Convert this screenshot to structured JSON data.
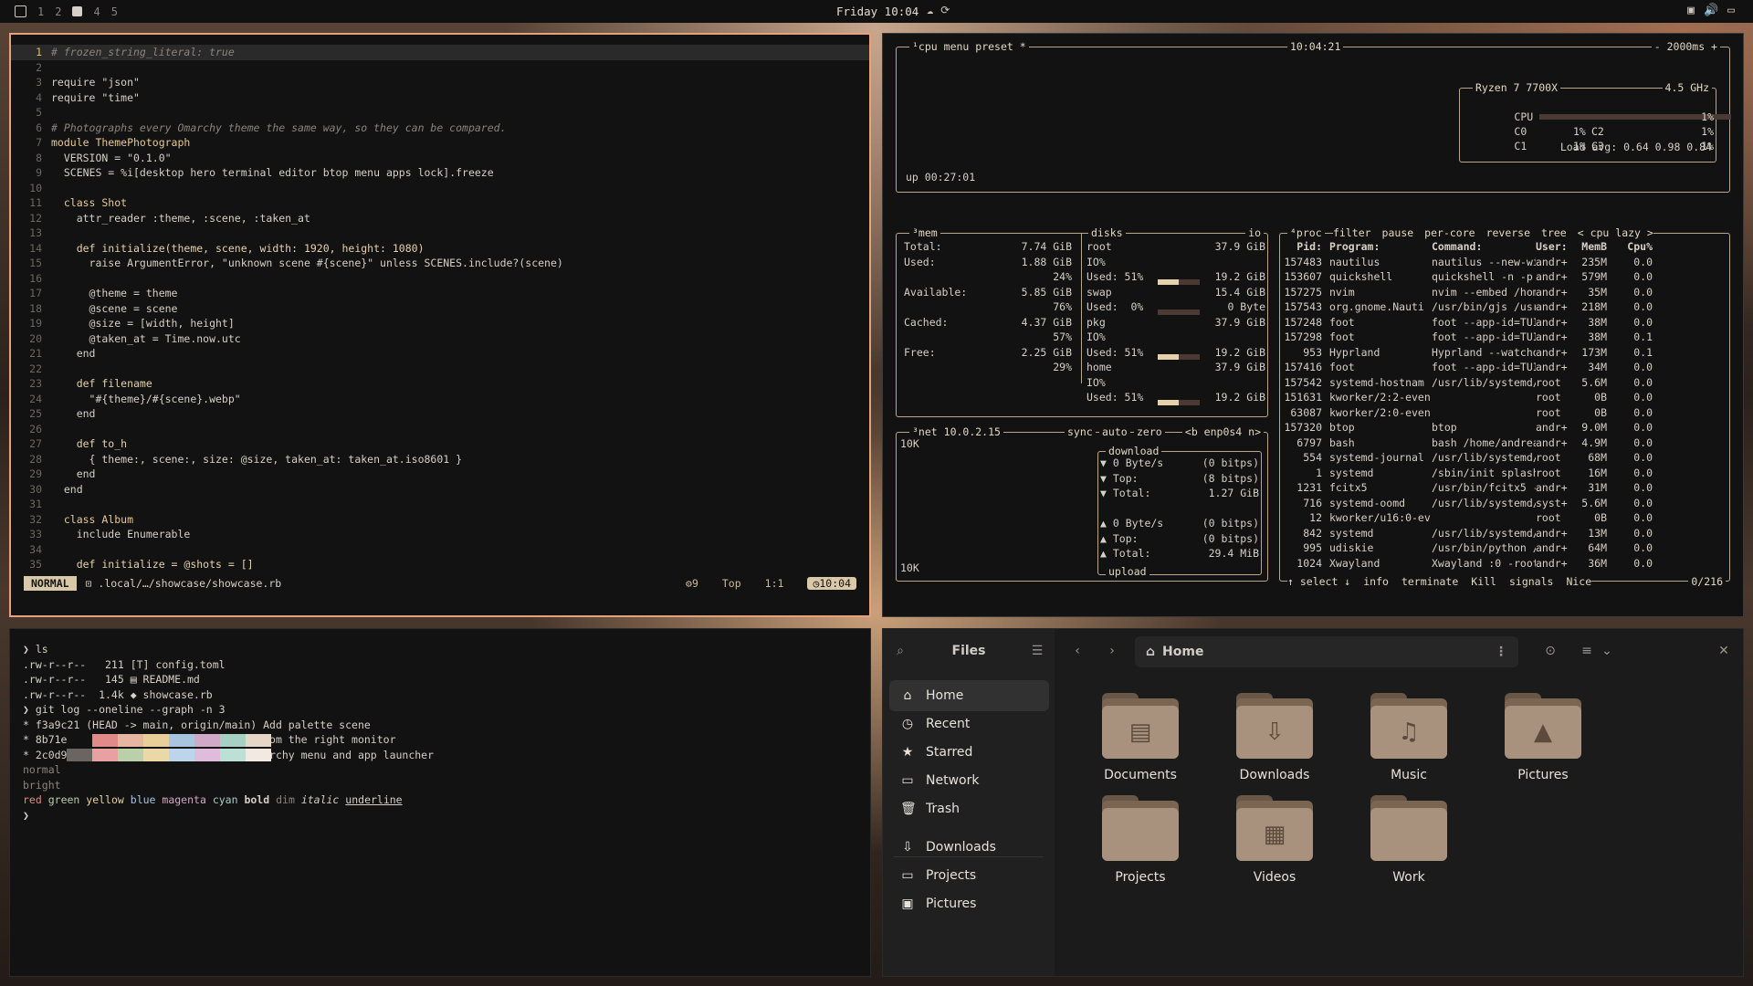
{
  "topbar": {
    "workspaces": [
      "1",
      "2",
      "4",
      "5"
    ],
    "clock": "Friday 10:04"
  },
  "editor": {
    "lines": [
      {
        "n": "1",
        "t": "# frozen_string_literal: true"
      },
      {
        "n": "2",
        "t": ""
      },
      {
        "n": "3",
        "t": "require \"json\""
      },
      {
        "n": "4",
        "t": "require \"time\""
      },
      {
        "n": "5",
        "t": ""
      },
      {
        "n": "6",
        "t": "# Photographs every Omarchy theme the same way, so they can be compared."
      },
      {
        "n": "7",
        "t": "module ThemePhotograph"
      },
      {
        "n": "8",
        "t": "  VERSION = \"0.1.0\""
      },
      {
        "n": "9",
        "t": "  SCENES = %i[desktop hero terminal editor btop menu apps lock].freeze"
      },
      {
        "n": "10",
        "t": ""
      },
      {
        "n": "11",
        "t": "  class Shot"
      },
      {
        "n": "12",
        "t": "    attr_reader :theme, :scene, :taken_at"
      },
      {
        "n": "13",
        "t": ""
      },
      {
        "n": "14",
        "t": "    def initialize(theme, scene, width: 1920, height: 1080)"
      },
      {
        "n": "15",
        "t": "      raise ArgumentError, \"unknown scene #{scene}\" unless SCENES.include?(scene)"
      },
      {
        "n": "16",
        "t": ""
      },
      {
        "n": "17",
        "t": "      @theme = theme"
      },
      {
        "n": "18",
        "t": "      @scene = scene"
      },
      {
        "n": "19",
        "t": "      @size = [width, height]"
      },
      {
        "n": "20",
        "t": "      @taken_at = Time.now.utc"
      },
      {
        "n": "21",
        "t": "    end"
      },
      {
        "n": "22",
        "t": ""
      },
      {
        "n": "23",
        "t": "    def filename"
      },
      {
        "n": "24",
        "t": "      \"#{theme}/#{scene}.webp\""
      },
      {
        "n": "25",
        "t": "    end"
      },
      {
        "n": "26",
        "t": ""
      },
      {
        "n": "27",
        "t": "    def to_h"
      },
      {
        "n": "28",
        "t": "      { theme:, scene:, size: @size, taken_at: taken_at.iso8601 }"
      },
      {
        "n": "29",
        "t": "    end"
      },
      {
        "n": "30",
        "t": "  end"
      },
      {
        "n": "31",
        "t": ""
      },
      {
        "n": "32",
        "t": "  class Album"
      },
      {
        "n": "33",
        "t": "    include Enumerable"
      },
      {
        "n": "34",
        "t": ""
      },
      {
        "n": "35",
        "t": "    def initialize = @shots = []"
      }
    ],
    "status": {
      "mode": "NORMAL",
      "path": ".local/…/showcase/showcase.rb",
      "count": "9",
      "position": "Top",
      "cursor": "1:1",
      "time": "10:04"
    }
  },
  "btop": {
    "cpu_box": {
      "title": "¹cpu",
      "menu": "menu",
      "preset": "preset *",
      "time": "10:04:21",
      "interval": "- 2000ms +",
      "uptime": "up 00:27:01",
      "cpu_name": "Ryzen 7 7700X",
      "freq": "4.5 GHz",
      "rows": [
        {
          "label": "CPU",
          "value": "1%"
        },
        {
          "label": "C0",
          "value": "1%",
          "label2": "C2",
          "value2": "1%"
        },
        {
          "label": "C1",
          "value": "1%",
          "label2": "C3",
          "value2": "1%"
        }
      ],
      "load": "Load avg: 0.64 0.98 0.84"
    },
    "mem_box": {
      "title": "³mem",
      "lines": [
        {
          "k": "Total:",
          "v": "7.74 GiB"
        },
        {
          "k": "Used:",
          "v": "1.88 GiB"
        },
        {
          "k": "",
          "v": "24%"
        },
        {
          "k": "Available:",
          "v": "5.85 GiB"
        },
        {
          "k": "",
          "v": "76%"
        },
        {
          "k": "Cached:",
          "v": "4.37 GiB"
        },
        {
          "k": "",
          "v": "57%"
        },
        {
          "k": "Free:",
          "v": "2.25 GiB"
        },
        {
          "k": "",
          "v": "29%"
        }
      ]
    },
    "disks_box": {
      "title": "disks",
      "io": "io",
      "disks": [
        {
          "name": "root",
          "size": "37.9 GiB",
          "io": "IO%",
          "used": "Used: 51%",
          "used_size": "19.2 GiB",
          "fill": 0.51
        },
        {
          "name": "swap",
          "size": "15.4 GiB",
          "io": "",
          "used": "Used:  0%",
          "used_size": "0 Byte",
          "fill": 0.0
        },
        {
          "name": "pkg",
          "size": "37.9 GiB",
          "io": "IO%",
          "used": "Used: 51%",
          "used_size": "19.2 GiB",
          "fill": 0.51
        },
        {
          "name": "home",
          "size": "37.9 GiB",
          "io": "IO%",
          "used": "Used: 51%",
          "used_size": "19.2 GiB",
          "fill": 0.51
        }
      ]
    },
    "net_box": {
      "title": "³net",
      "ip": "10.0.2.15",
      "sync": "sync",
      "auto": "auto",
      "zero": "zero",
      "iface": "<b enp0s4 n>",
      "scale_top": "10K",
      "scale_bottom": "10K",
      "download_label": "download",
      "upload_label": "upload",
      "down": [
        {
          "k": "▼ 0 Byte/s",
          "v": "(0 bitps)"
        },
        {
          "k": "▼ Top:",
          "v": "(8 bitps)"
        },
        {
          "k": "▼ Total:",
          "v": "1.27 GiB"
        }
      ],
      "up": [
        {
          "k": "▲ 0 Byte/s",
          "v": "(0 bitps)"
        },
        {
          "k": "▲ Top:",
          "v": "(0 bitps)"
        },
        {
          "k": "▲ Total:",
          "v": "29.4 MiB"
        }
      ]
    },
    "proc_box": {
      "title": "⁴proc",
      "tabs": [
        "filter",
        "pause",
        "per-core",
        "reverse",
        "tree",
        "< cpu lazy >"
      ],
      "headers": [
        "Pid:",
        "Program:",
        "Command:",
        "User:",
        "MemB",
        "Cpu%"
      ],
      "rows": [
        [
          "157483",
          "nautilus",
          "nautilus --new-win",
          "andr+",
          "235M",
          "0.0"
        ],
        [
          "153607",
          "quickshell",
          "quickshell -n -p /",
          "andr+",
          "579M",
          "0.0"
        ],
        [
          "157275",
          "nvim",
          "nvim --embed /home",
          "andr+",
          "35M",
          "0.0"
        ],
        [
          "157543",
          "org.gnome.Nauti",
          "/usr/bin/gjs /usr/",
          "andr+",
          "218M",
          "0.0"
        ],
        [
          "157248",
          "foot",
          "foot --app-id=TUI.",
          "andr+",
          "38M",
          "0.0"
        ],
        [
          "157298",
          "foot",
          "foot --app-id=TUI.",
          "andr+",
          "38M",
          "0.1"
        ],
        [
          "953",
          "Hyprland",
          "Hyprland --watchdo",
          "andr+",
          "173M",
          "0.1"
        ],
        [
          "157416",
          "foot",
          "foot --app-id=TUI.",
          "andr+",
          "34M",
          "0.0"
        ],
        [
          "157542",
          "systemd-hostnam",
          "/usr/lib/systemd/s",
          "root",
          "5.6M",
          "0.0"
        ],
        [
          "151631",
          "kworker/2:2-even",
          "",
          "root",
          "0B",
          "0.0"
        ],
        [
          "63087",
          "kworker/2:0-even",
          "",
          "root",
          "0B",
          "0.0"
        ],
        [
          "157320",
          "btop",
          "btop",
          "andr+",
          "9.0M",
          "0.0"
        ],
        [
          "6797",
          "bash",
          "bash /home/andreas",
          "andr+",
          "4.9M",
          "0.0"
        ],
        [
          "554",
          "systemd-journal",
          "/usr/lib/systemd/s",
          "root",
          "68M",
          "0.0"
        ],
        [
          "1",
          "systemd",
          "/sbin/init splash",
          "root",
          "16M",
          "0.0"
        ],
        [
          "1231",
          "fcitx5",
          "/usr/bin/fcitx5 --",
          "andr+",
          "31M",
          "0.0"
        ],
        [
          "716",
          "systemd-oomd",
          "/usr/lib/systemd/s",
          "syst+",
          "5.6M",
          "0.0"
        ],
        [
          "12",
          "kworker/u16:0-ev",
          "",
          "root",
          "0B",
          "0.0"
        ],
        [
          "842",
          "systemd",
          "/usr/lib/systemd/s",
          "andr+",
          "13M",
          "0.0"
        ],
        [
          "995",
          "udiskie",
          "/usr/bin/python /u",
          "andr+",
          "64M",
          "0.0"
        ],
        [
          "1024",
          "Xwayland",
          "Xwayland :0 -rootl",
          "andr+",
          "36M",
          "0.0"
        ]
      ],
      "footer": [
        "↑ select ↓",
        "info",
        "terminate",
        "Kill",
        "signals",
        "Nice"
      ],
      "count": "0/216"
    }
  },
  "terminal": {
    "lines": [
      {
        "t": "❯ ls"
      },
      {
        "t": ".rw-r--r--   211 [T] config.toml"
      },
      {
        "t": ".rw-r--r--   145 ▤ README.md"
      },
      {
        "t": ".rw-r--r--  1.4k ◆ showcase.rb"
      },
      {
        "t": "❯ git log --oneline --graph -n 3"
      },
      {
        "t": "* f3a9c21 (HEAD -> main, origin/main) Add palette scene"
      },
      {
        "t": "* 8b71e04 Photograph the lock screen from the right monitor"
      },
      {
        "t": "* 2c0d9aa (tag: v0.1.0) Capture the Omarchy menu and app launcher"
      }
    ],
    "normal_label": "normal",
    "bright_label": "bright",
    "normal_colors": [
      "#121212",
      "#e08a8a",
      "#e6b6a0",
      "#e8cf9a",
      "#a9c4de",
      "#d0a8c8",
      "#a8cfc4",
      "#e6d6c6"
    ],
    "bright_colors": [
      "#6a6560",
      "#e8a0a0",
      "#b9d0a8",
      "#ead8a8",
      "#bcd4ec",
      "#e0bcdc",
      "#bce0d6",
      "#f2eae0"
    ],
    "styles": [
      "red",
      "green",
      "yellow",
      "blue",
      "magenta",
      "cyan",
      "bold",
      "dim",
      "italic",
      "underline"
    ],
    "prompt": "❯"
  },
  "files": {
    "title": "Files",
    "path": "Home",
    "sidebar": [
      {
        "label": "Home",
        "icon": "home-icon",
        "glyph": "⌂"
      },
      {
        "label": "Recent",
        "icon": "clock-icon",
        "glyph": "◷"
      },
      {
        "label": "Starred",
        "icon": "star-icon",
        "glyph": "★"
      },
      {
        "label": "Network",
        "icon": "network-icon",
        "glyph": "▭"
      },
      {
        "label": "Trash",
        "icon": "trash-icon",
        "glyph": "🗑"
      },
      {
        "label": "Downloads",
        "icon": "download-icon",
        "glyph": "⇩"
      },
      {
        "label": "Projects",
        "icon": "folder-icon",
        "glyph": "▭"
      },
      {
        "label": "Pictures",
        "icon": "image-icon",
        "glyph": "▣"
      }
    ],
    "folders": [
      {
        "label": "Documents",
        "glyph": "▤"
      },
      {
        "label": "Downloads",
        "glyph": "⇩"
      },
      {
        "label": "Music",
        "glyph": "♫"
      },
      {
        "label": "Pictures",
        "glyph": "▲"
      },
      {
        "label": "Projects",
        "glyph": ""
      },
      {
        "label": "Videos",
        "glyph": "▦"
      },
      {
        "label": "Work",
        "glyph": ""
      }
    ]
  }
}
